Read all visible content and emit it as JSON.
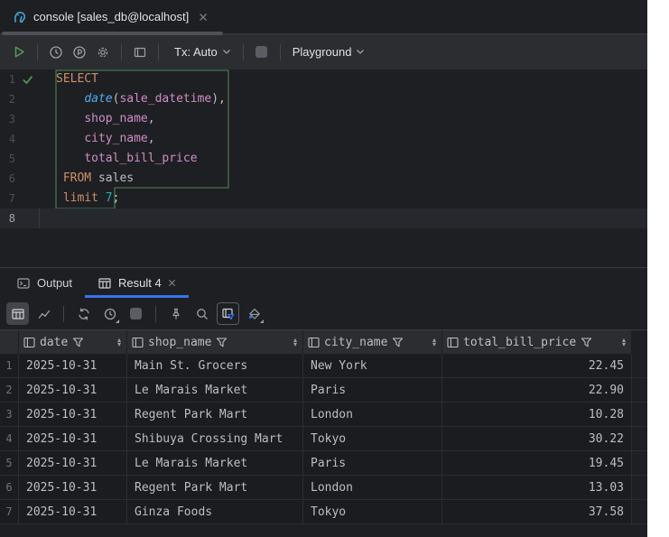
{
  "colors": {
    "accent": "#3574F0",
    "green": "#57965C",
    "keyword": "#CF8E6D",
    "function": "#56A8F5",
    "column": "#CE8EC6",
    "number": "#2AACB8",
    "editor_text": "#BCBEC4",
    "panel": "#2B2D30"
  },
  "window": {
    "tab_title": "console [sales_db@localhost]"
  },
  "toolbar": {
    "tx_label": "Tx: Auto",
    "playground_label": "Playground"
  },
  "editor": {
    "lines": [
      {
        "num": "1",
        "check": true,
        "tokens": [
          {
            "t": "SELECT",
            "c": "kw"
          }
        ]
      },
      {
        "num": "2",
        "tokens": [
          {
            "t": "    ",
            "c": "pl"
          },
          {
            "t": "date",
            "c": "fn"
          },
          {
            "t": "(",
            "c": "pl"
          },
          {
            "t": "sale_datetime",
            "c": "col"
          },
          {
            "t": "),",
            "c": "pl"
          }
        ]
      },
      {
        "num": "3",
        "tokens": [
          {
            "t": "    ",
            "c": "pl"
          },
          {
            "t": "shop_name",
            "c": "col"
          },
          {
            "t": ",",
            "c": "pl"
          }
        ]
      },
      {
        "num": "4",
        "tokens": [
          {
            "t": "    ",
            "c": "pl"
          },
          {
            "t": "city_name",
            "c": "col"
          },
          {
            "t": ",",
            "c": "pl"
          }
        ]
      },
      {
        "num": "5",
        "tokens": [
          {
            "t": "    ",
            "c": "pl"
          },
          {
            "t": "total_bill_price",
            "c": "col"
          }
        ]
      },
      {
        "num": "6",
        "tokens": [
          {
            "t": " ",
            "c": "pl"
          },
          {
            "t": "FROM",
            "c": "kw"
          },
          {
            "t": " sales",
            "c": "pl"
          }
        ]
      },
      {
        "num": "7",
        "tokens": [
          {
            "t": " ",
            "c": "pl"
          },
          {
            "t": "limit",
            "c": "kw"
          },
          {
            "t": " ",
            "c": "pl"
          },
          {
            "t": "7",
            "c": "num"
          },
          {
            "t": ";",
            "c": "pl"
          }
        ]
      },
      {
        "num": "8",
        "current": true,
        "tokens": []
      }
    ]
  },
  "toolwindow": {
    "tabs": [
      {
        "label": "Output"
      },
      {
        "label": "Result 4",
        "active": true,
        "closable": true
      }
    ]
  },
  "grid": {
    "columns": [
      "date",
      "shop_name",
      "city_name",
      "total_bill_price"
    ],
    "rows": [
      {
        "num": "1",
        "cells": [
          "2025-10-31",
          "Main St. Grocers",
          "New York",
          "22.45"
        ]
      },
      {
        "num": "2",
        "cells": [
          "2025-10-31",
          "Le Marais Market",
          "Paris",
          "22.90"
        ]
      },
      {
        "num": "3",
        "cells": [
          "2025-10-31",
          "Regent Park Mart",
          "London",
          "10.28"
        ]
      },
      {
        "num": "4",
        "cells": [
          "2025-10-31",
          "Shibuya Crossing Mart",
          "Tokyo",
          "30.22"
        ]
      },
      {
        "num": "5",
        "cells": [
          "2025-10-31",
          "Le Marais Market",
          "Paris",
          "19.45"
        ]
      },
      {
        "num": "6",
        "cells": [
          "2025-10-31",
          "Regent Park Mart",
          "London",
          "13.03"
        ]
      },
      {
        "num": "7",
        "cells": [
          "2025-10-31",
          "Ginza Foods",
          "Tokyo",
          "37.58"
        ]
      }
    ]
  }
}
